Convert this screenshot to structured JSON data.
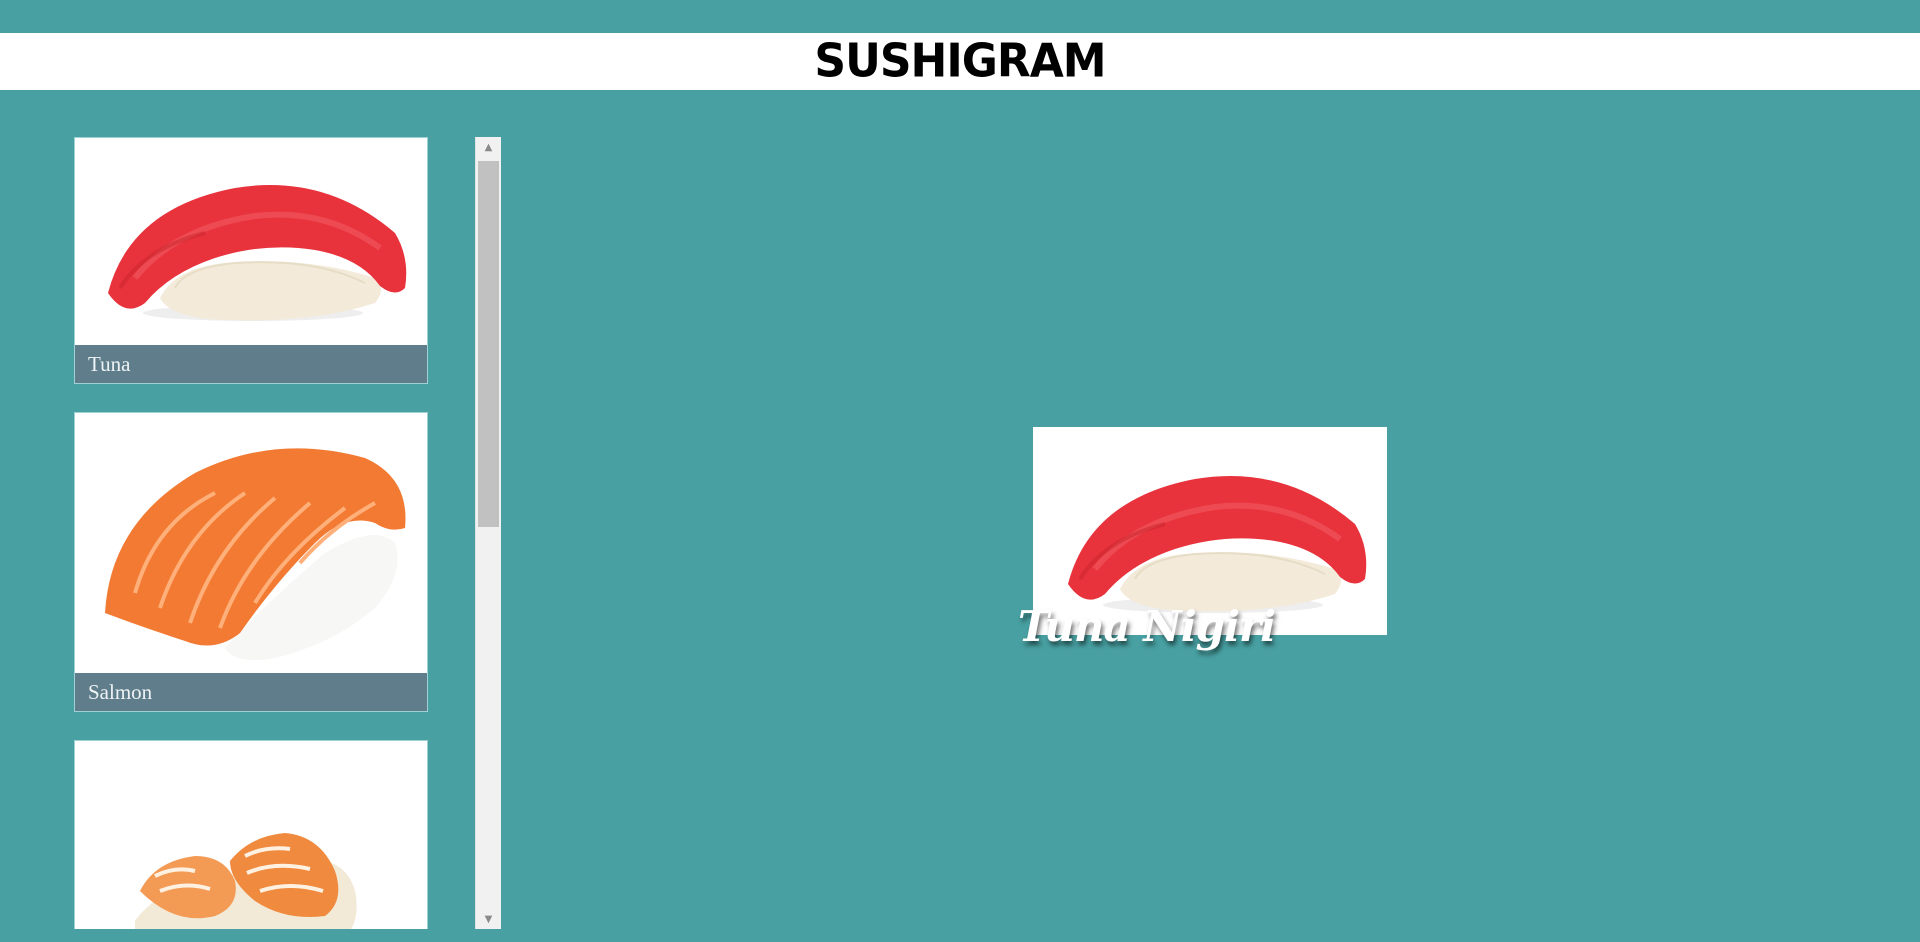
{
  "app": {
    "logo_text": "SUSHIGRAM"
  },
  "colors": {
    "background": "#48a0a2",
    "caption_bar": "#607d8b",
    "header": "#ffffff"
  },
  "list": {
    "items": [
      {
        "label": "Tuna",
        "image": "tuna-nigiri-image"
      },
      {
        "label": "Salmon",
        "image": "salmon-nigiri-image"
      },
      {
        "label": "",
        "image": "shrimp-nigiri-image"
      }
    ]
  },
  "detail": {
    "title": "Tuna Nigiri",
    "image": "tuna-nigiri-image"
  },
  "scrollbar": {
    "up_icon": "scroll-up-arrow-icon",
    "down_icon": "scroll-down-arrow-icon"
  }
}
